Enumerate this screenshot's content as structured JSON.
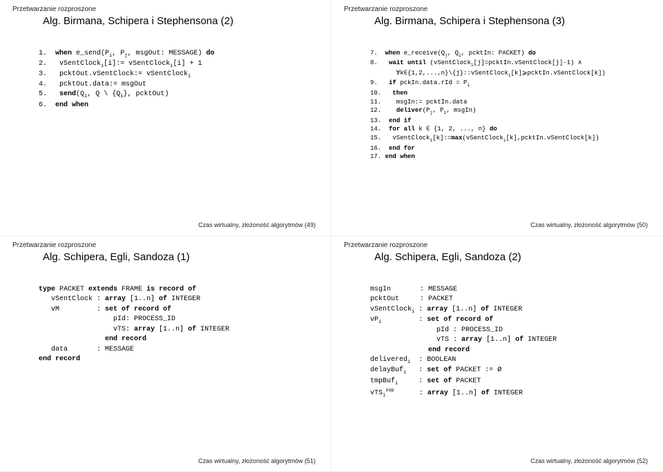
{
  "common": {
    "category": "Przetwarzanie rozproszone"
  },
  "slides": [
    {
      "title": "Alg. Birmana, Schipera i Stephensona (2)",
      "footer": "Czas wirtualny, złożoność algorytmów (49)",
      "code": "1.  <b>when</b> e_send(P<sub>i</sub>, P<sub>j</sub>, msgOut: MESSAGE) <b>do</b>\n2.   vSentClock<sub>i</sub>[i]:= vSentClock<sub>i</sub>[i] + 1\n3.   pcktOut.vSentClock:= vSentClock<sub>i</sub>\n4.   pcktOut.data:= msgOut\n5.   <b>send</b>(Q<sub>i</sub>, Q \\ {Q<sub>i</sub>}, pcktOut)\n6.  <b>end when</b>"
    },
    {
      "title": "Alg. Birmana, Schipera i Stephensona (3)",
      "footer": "Czas wirtualny, złożoność algorytmów (50)",
      "code": "7.  <b>when</b> e_receive(Q<sub>j</sub>, Q<sub>i</sub>, pcktIn: PACKET) <b>do</b>\n8.   <b>wait until</b> (vSentClock<sub>i</sub>[j]=pcktIn.vSentClock[j]-1) ∧\n       ∀k∈{1,2,...,n}\\{j}::vSentClock<sub>i</sub>[k]⩾pcktIn.vSentClock[k])\n9.   <b>if</b> pckIn.data.rId = P<sub>i</sub>\n10.   <b>then</b>\n11.    msgIn:= pcktIn.data\n12.    <b>deliver</b>(P<sub>j</sub>, P<sub>i</sub>, msgIn)\n13.  <b>end if</b>\n14.  <b>for all</b> k ∈ {1, 2, ..., n} <b>do</b>\n15.   vSentClock<sub>i</sub>[k]:=<b>max</b>(vSentClock<sub>i</sub>[k],pcktIn.vSentClock[k])\n16.  <b>end for</b>\n17. <b>end when</b>"
    },
    {
      "title": "Alg. Schipera, Egli, Sandoza (1)",
      "footer": "Czas wirtualny, złożoność algorytmów (51)",
      "code": "<b>type</b> PACKET <b>extends</b> FRAME <b>is record of</b>\n   vSentClock : <b>array</b> [1..n] <b>of</b> INTEGER\n   vM         : <b>set of record of</b>\n                  pId: PROCESS_ID\n                  vTS: <b>array</b> [1..n] <b>of</b> INTEGER\n                <b>end record</b>\n   data       : MESSAGE\n<b>end record</b>"
    },
    {
      "title": "Alg. Schipera, Egli, Sandoza (2)",
      "footer": "Czas wirtualny, złożoność algorytmów (52)",
      "code": "msgIn       : MESSAGE\npcktOut     : PACKET\nvSentClock<sub>i</sub> : <b>array</b> [1..n] <b>of</b> INTEGER\nvP<sub>i</sub>         : <b>set of record of</b>\n                pId : PROCESS_ID\n                vTS : <b>array</b> [1..n] <b>of</b> INTEGER\n              <b>end record</b>\ndelivered<sub>i</sub>  : BOOLEAN\ndelayBuf<sub>i</sub>   : <b>set of</b> PACKET := Ø\ntmpBuf<sub>i</sub>     : <b>set of</b> PACKET\nvTS<sub>i</sub><sup>sup</sup>      : <b>array</b> [1..n] <b>of</b> INTEGER"
    }
  ]
}
